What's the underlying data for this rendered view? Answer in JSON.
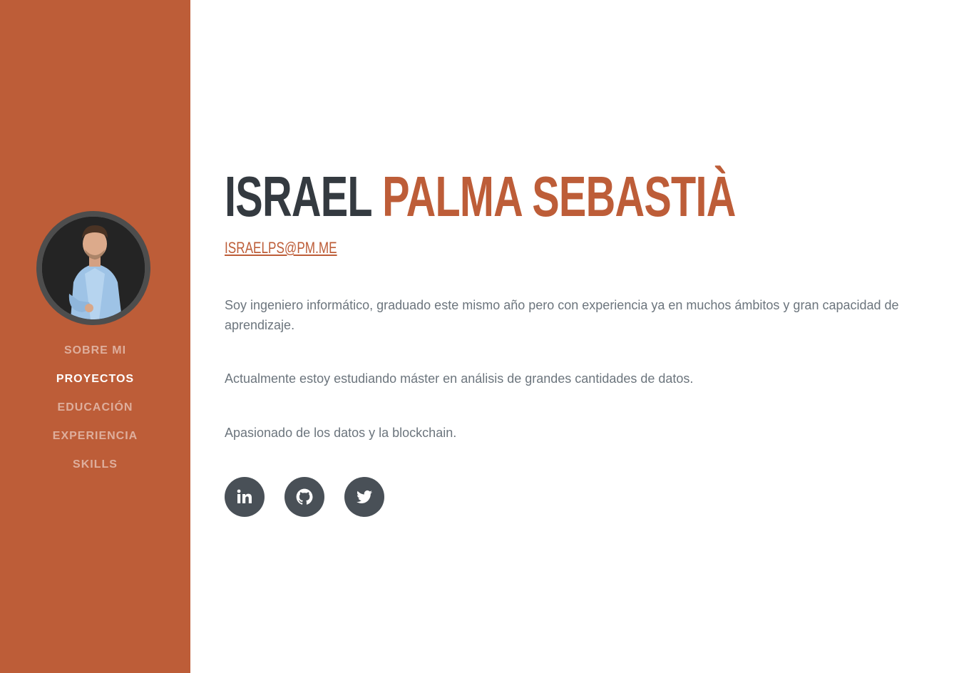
{
  "profile": {
    "first_name": "Israel",
    "last_name": "Palma Sebastià",
    "email": "israelps@pm.me"
  },
  "nav": {
    "items": [
      {
        "label": "Sobre mi",
        "active": false
      },
      {
        "label": "Proyectos",
        "active": true
      },
      {
        "label": "Educación",
        "active": false
      },
      {
        "label": "Experiencia",
        "active": false
      },
      {
        "label": "Skills",
        "active": false
      }
    ]
  },
  "about": {
    "paragraphs": [
      "Soy ingeniero informático, graduado este mismo año pero con experiencia ya en muchos ámbitos y gran capacidad de aprendizaje.",
      "Actualmente estoy estudiando máster en análisis de grandes cantidades de datos.",
      "Apasionado de los datos y la blockchain."
    ]
  },
  "social": {
    "icons": [
      "linkedin-icon",
      "github-icon",
      "twitter-icon"
    ]
  },
  "colors": {
    "primary": "#bd5d38",
    "dark": "#343a40",
    "text": "#6c757d",
    "social_bg": "#495057"
  }
}
